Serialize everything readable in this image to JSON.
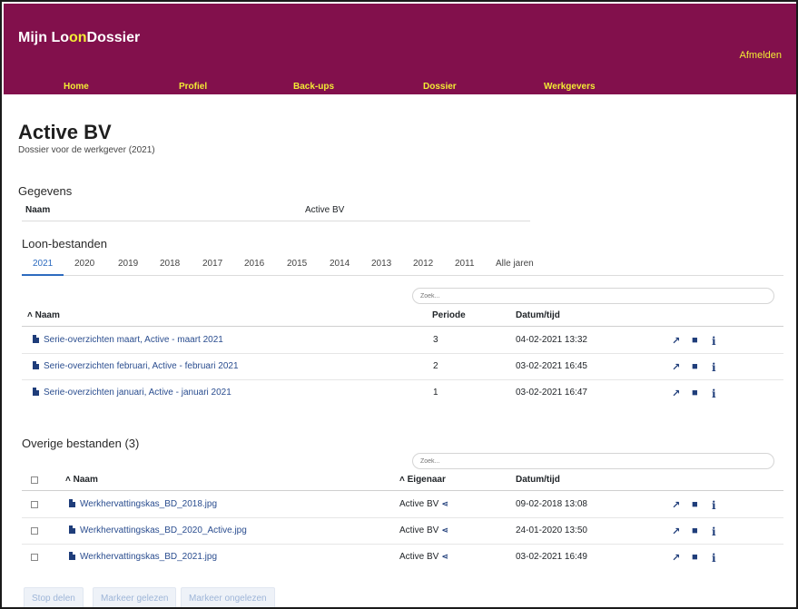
{
  "brand": {
    "part1": "Mijn Lo",
    "part2": "on",
    "part3": "Dossier"
  },
  "header": {
    "logout_label": "Afmelden"
  },
  "nav": [
    {
      "label": "Home"
    },
    {
      "label": "Profiel"
    },
    {
      "label": "Back-ups"
    },
    {
      "label": "Dossier"
    },
    {
      "label": "Werkgevers"
    }
  ],
  "page": {
    "title": "Active BV",
    "subtitle": "Dossier voor de werkgever (2021)"
  },
  "gegevens": {
    "heading": "Gegevens",
    "key": "Naam",
    "value": "Active BV"
  },
  "loon": {
    "heading": "Loon-bestanden",
    "tabs": [
      "2021",
      "2020",
      "2019",
      "2018",
      "2017",
      "2016",
      "2015",
      "2014",
      "2013",
      "2012",
      "2011",
      "Alle jaren"
    ],
    "active_tab": "2021",
    "search_placeholder": "Zoek...",
    "columns": {
      "name": "˄ Naam",
      "period": "Periode",
      "datetime": "Datum/tijd"
    },
    "rows": [
      {
        "name": "Serie-overzichten maart, Active - maart 2021",
        "period": "3",
        "datetime": "04-02-2021 13:32"
      },
      {
        "name": "Serie-overzichten februari, Active - februari 2021",
        "period": "2",
        "datetime": "03-02-2021 16:45"
      },
      {
        "name": "Serie-overzichten januari, Active - januari 2021",
        "period": "1",
        "datetime": "03-02-2021 16:47"
      }
    ]
  },
  "overige": {
    "heading": "Overige bestanden (3)",
    "search_placeholder": "Zoek...",
    "columns": {
      "name": "˄ Naam",
      "owner": "˄ Eigenaar",
      "datetime": "Datum/tijd"
    },
    "rows": [
      {
        "name": "Werkhervattingskas_BD_2018.jpg",
        "owner": "Active BV",
        "datetime": "09-02-2018 13:08"
      },
      {
        "name": "Werkhervattingskas_BD_2020_Active.jpg",
        "owner": "Active BV",
        "datetime": "24-01-2020 13:50"
      },
      {
        "name": "Werkhervattingskas_BD_2021.jpg",
        "owner": "Active BV",
        "datetime": "03-02-2021 16:49"
      }
    ]
  },
  "actions": {
    "edit_icon": "↗",
    "download_icon": "■",
    "info_icon": "i",
    "share_icon": "⋖"
  },
  "buttons": {
    "stop_share": "Stop delen",
    "mark_read": "Markeer gelezen",
    "mark_unread": "Markeer ongelezen"
  },
  "colors": {
    "header_bg": "#82104c",
    "accent": "#f2ec34",
    "link": "#2a4d8f"
  }
}
